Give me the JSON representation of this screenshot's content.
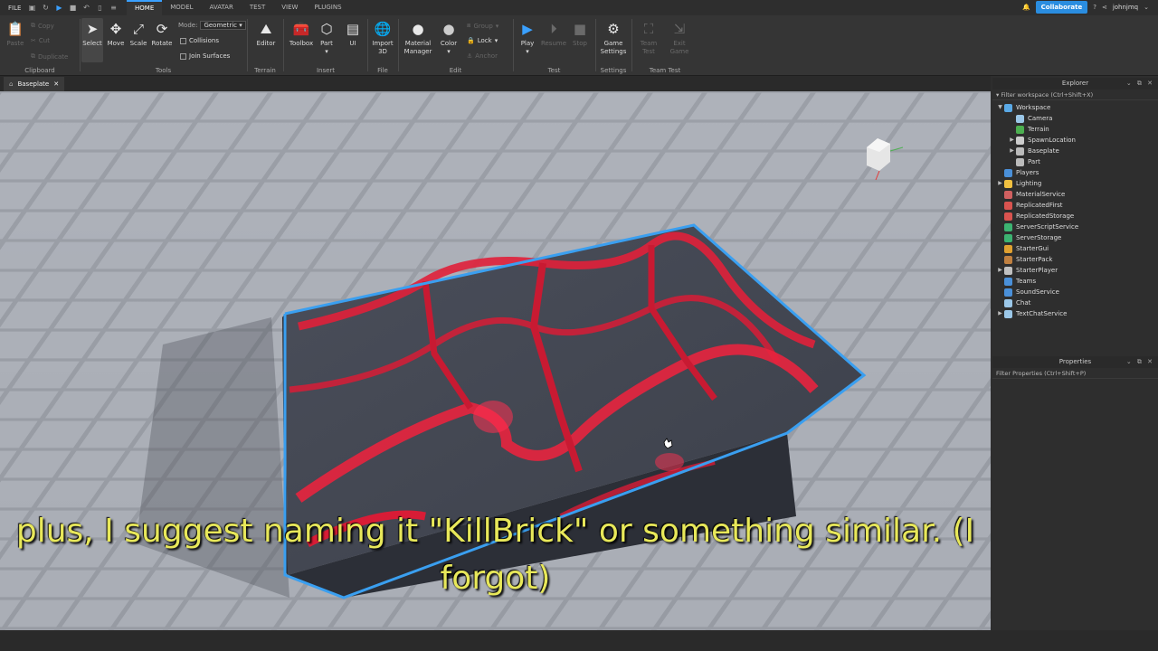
{
  "menubar": {
    "file": "FILE",
    "tabs": [
      "HOME",
      "MODEL",
      "AVATAR",
      "TEST",
      "VIEW",
      "PLUGINS"
    ],
    "active_tab": "HOME",
    "collaborate": "Collaborate",
    "username": "johnjmq"
  },
  "ribbon": {
    "clipboard": {
      "paste": "Paste",
      "copy": "Copy",
      "cut": "Cut",
      "duplicate": "Duplicate",
      "label": "Clipboard"
    },
    "tools": {
      "select": "Select",
      "move": "Move",
      "scale": "Scale",
      "rotate": "Rotate",
      "mode_label": "Mode:",
      "mode_value": "Geometric",
      "collisions": "Collisions",
      "join_surfaces": "Join Surfaces",
      "label": "Tools"
    },
    "terrain": {
      "editor": "Editor",
      "label": "Terrain"
    },
    "insert": {
      "toolbox": "Toolbox",
      "part": "Part",
      "ui": "UI",
      "label": "Insert"
    },
    "file": {
      "import3d_1": "Import",
      "import3d_2": "3D",
      "label": "File"
    },
    "edit": {
      "material1": "Material",
      "material2": "Manager",
      "color": "Color",
      "group": "Group",
      "lock": "Lock",
      "anchor": "Anchor",
      "label": "Edit"
    },
    "test": {
      "play": "Play",
      "resume": "Resume",
      "stop": "Stop",
      "label": "Test"
    },
    "settings": {
      "game1": "Game",
      "game2": "Settings",
      "label": "Settings"
    },
    "teamtest": {
      "team1": "Team",
      "team2": "Test",
      "exit1": "Exit",
      "exit2": "Game",
      "label": "Team Test"
    }
  },
  "doc_tab": {
    "title": "Baseplate",
    "close": "✕"
  },
  "explorer": {
    "title": "Explorer",
    "filter": "Filter workspace (Ctrl+Shift+X)",
    "items": [
      {
        "label": "Workspace",
        "indent": 0,
        "arrow": "▼",
        "color": "#5aa9e6"
      },
      {
        "label": "Camera",
        "indent": 1,
        "arrow": "",
        "color": "#9bc7e8"
      },
      {
        "label": "Terrain",
        "indent": 1,
        "arrow": "",
        "color": "#4caf50"
      },
      {
        "label": "SpawnLocation",
        "indent": 1,
        "arrow": "▶",
        "color": "#cccccc"
      },
      {
        "label": "Baseplate",
        "indent": 1,
        "arrow": "▶",
        "color": "#bbbbbb"
      },
      {
        "label": "Part",
        "indent": 1,
        "arrow": "",
        "color": "#bbbbbb"
      },
      {
        "label": "Players",
        "indent": 0,
        "arrow": "",
        "color": "#4a90d9"
      },
      {
        "label": "Lighting",
        "indent": 0,
        "arrow": "▶",
        "color": "#f0c040"
      },
      {
        "label": "MaterialService",
        "indent": 0,
        "arrow": "",
        "color": "#d06060"
      },
      {
        "label": "ReplicatedFirst",
        "indent": 0,
        "arrow": "",
        "color": "#d9534f"
      },
      {
        "label": "ReplicatedStorage",
        "indent": 0,
        "arrow": "",
        "color": "#d9534f"
      },
      {
        "label": "ServerScriptService",
        "indent": 0,
        "arrow": "",
        "color": "#3cb371"
      },
      {
        "label": "ServerStorage",
        "indent": 0,
        "arrow": "",
        "color": "#3cb371"
      },
      {
        "label": "StarterGui",
        "indent": 0,
        "arrow": "",
        "color": "#e0a030"
      },
      {
        "label": "StarterPack",
        "indent": 0,
        "arrow": "",
        "color": "#c08040"
      },
      {
        "label": "StarterPlayer",
        "indent": 0,
        "arrow": "▶",
        "color": "#c0c0c0"
      },
      {
        "label": "Teams",
        "indent": 0,
        "arrow": "",
        "color": "#4a90d9"
      },
      {
        "label": "SoundService",
        "indent": 0,
        "arrow": "",
        "color": "#4a90d9"
      },
      {
        "label": "Chat",
        "indent": 0,
        "arrow": "",
        "color": "#9bc7e8"
      },
      {
        "label": "TextChatService",
        "indent": 0,
        "arrow": "▶",
        "color": "#9bc7e8"
      }
    ]
  },
  "properties": {
    "title": "Properties",
    "filter": "Filter Properties (Ctrl+Shift+P)"
  },
  "subtitle": {
    "line1": "plus, I suggest naming it \"KillBrick\" or something similar. (I",
    "line2": "forgot)"
  },
  "colors": {
    "accent": "#3aa0ff",
    "selection_outline": "#3a9ff0",
    "lava": "#e0203a",
    "rock": "#3a3e48"
  }
}
